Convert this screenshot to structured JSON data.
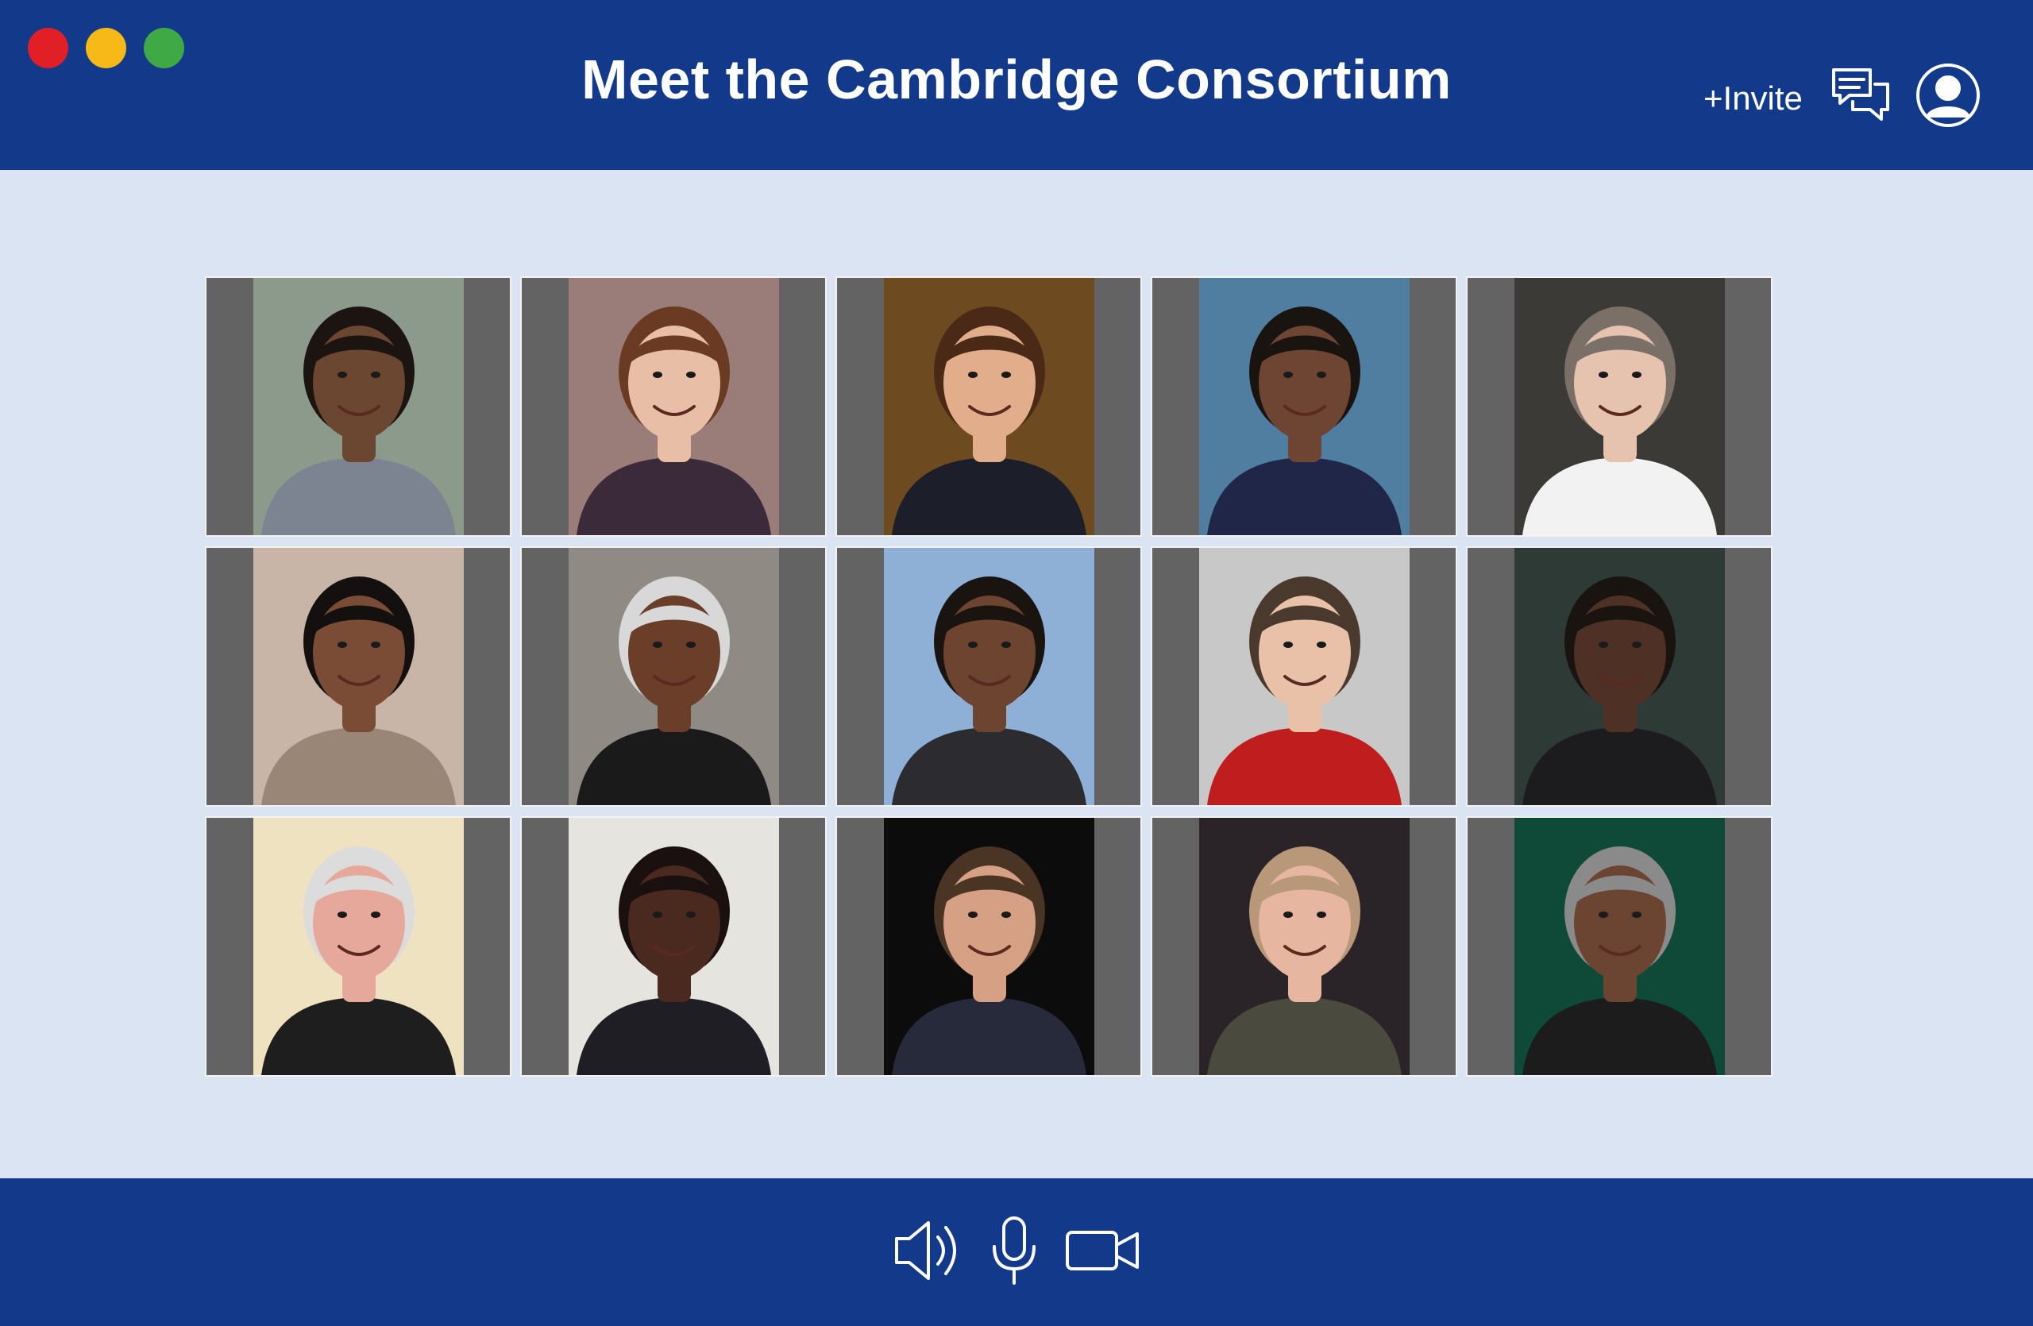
{
  "window": {
    "title": "Meet the Cambridge Consortium",
    "controls": [
      {
        "name": "close",
        "color": "#e01f26"
      },
      {
        "name": "minimize",
        "color": "#f6b918"
      },
      {
        "name": "maximize",
        "color": "#3faa45"
      }
    ]
  },
  "header": {
    "invite_label": "+Invite",
    "icons": [
      "chat-icon",
      "user-profile-icon"
    ]
  },
  "participants": [
    {
      "bg": "#8c9a8c",
      "skin": "#6b4630",
      "hair": "#1c1410",
      "shirt": "#7b8490"
    },
    {
      "bg": "#9a7c78",
      "skin": "#e8bfa6",
      "hair": "#6a3b22",
      "shirt": "#3b2a3a"
    },
    {
      "bg": "#6e4a20",
      "skin": "#e2ad8a",
      "hair": "#4a2a16",
      "shirt": "#1c1e2a"
    },
    {
      "bg": "#4f7ea0",
      "skin": "#6e4432",
      "hair": "#1a1410",
      "shirt": "#1f2647"
    },
    {
      "bg": "#3b3a36",
      "skin": "#e6c3ae",
      "hair": "#7a7068",
      "shirt": "#f2f2f2"
    },
    {
      "bg": "#c9b5a8",
      "skin": "#7a4c36",
      "hair": "#151010",
      "shirt": "#9a8676"
    },
    {
      "bg": "#8f8a84",
      "skin": "#6a3e28",
      "hair": "#d8d8d8",
      "shirt": "#1a1a1a"
    },
    {
      "bg": "#8fb0d6",
      "skin": "#6d4430",
      "hair": "#1a1410",
      "shirt": "#2c2c30"
    },
    {
      "bg": "#c8c8c8",
      "skin": "#e8c1a8",
      "hair": "#4a3a2e",
      "shirt": "#c01e1e"
    },
    {
      "bg": "#2e3a36",
      "skin": "#4f3024",
      "hair": "#1a1410",
      "shirt": "#1c1c1e"
    },
    {
      "bg": "#efe2c0",
      "skin": "#e6a89a",
      "hair": "#dcdcdc",
      "shirt": "#1e1e1e"
    },
    {
      "bg": "#e6e4de",
      "skin": "#4a2a1e",
      "hair": "#1a1010",
      "shirt": "#1e1e24"
    },
    {
      "bg": "#0c0c0c",
      "skin": "#d6a084",
      "hair": "#4a3424",
      "shirt": "#262a3a"
    },
    {
      "bg": "#2a2428",
      "skin": "#e6b6a0",
      "hair": "#b89878",
      "shirt": "#4a4a3e"
    },
    {
      "bg": "#0f4a38",
      "skin": "#6b4432",
      "hair": "#8a8a8a",
      "shirt": "#1c1c1c"
    }
  ],
  "footer": {
    "icons": [
      "speaker-icon",
      "microphone-icon",
      "video-camera-icon"
    ]
  }
}
